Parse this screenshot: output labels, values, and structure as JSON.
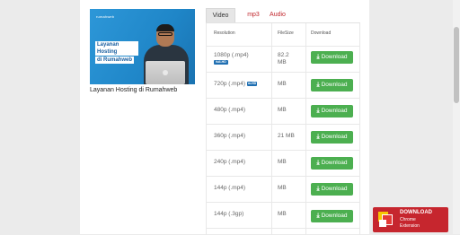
{
  "video": {
    "brand": "rumahweb",
    "thumb_title_line1": "Layanan Hosting",
    "thumb_title_line2": "di Rumahweb",
    "title": "Layanan Hosting di Rumahweb"
  },
  "tabs": [
    {
      "label": "Video",
      "active": true
    },
    {
      "label": "mp3",
      "active": false
    },
    {
      "label": "Audio",
      "active": false
    }
  ],
  "table": {
    "headers": {
      "resolution": "Resolution",
      "filesize": "FileSize",
      "download": "Download"
    },
    "rows": [
      {
        "resolution": "1080p (.mp4)",
        "badge": "full-HD",
        "size_line1": "82.2",
        "size_line2": "MB",
        "button": "Download"
      },
      {
        "resolution": "720p (.mp4)",
        "badge": "m-HD",
        "size_line1": "MB",
        "size_line2": "",
        "button": "Download"
      },
      {
        "resolution": "480p (.mp4)",
        "badge": "",
        "size_line1": "MB",
        "size_line2": "",
        "button": "Download"
      },
      {
        "resolution": "360p (.mp4)",
        "badge": "",
        "size_line1": "21 MB",
        "size_line2": "",
        "button": "Download"
      },
      {
        "resolution": "240p (.mp4)",
        "badge": "",
        "size_line1": "MB",
        "size_line2": "",
        "button": "Download"
      },
      {
        "resolution": "144p (.mp4)",
        "badge": "",
        "size_line1": "MB",
        "size_line2": "",
        "button": "Download"
      },
      {
        "resolution": "144p (.3gp)",
        "badge": "",
        "size_line1": "MB",
        "size_line2": "",
        "button": "Download"
      }
    ]
  },
  "extension": {
    "line1": "DOWNLOAD",
    "line2": "Chrome",
    "line3": "Extension"
  },
  "colors": {
    "accent_green": "#4caf50",
    "tab_link": "#c1272d",
    "extension_red": "#c6262e",
    "hd_badge": "#1f6fb2"
  }
}
